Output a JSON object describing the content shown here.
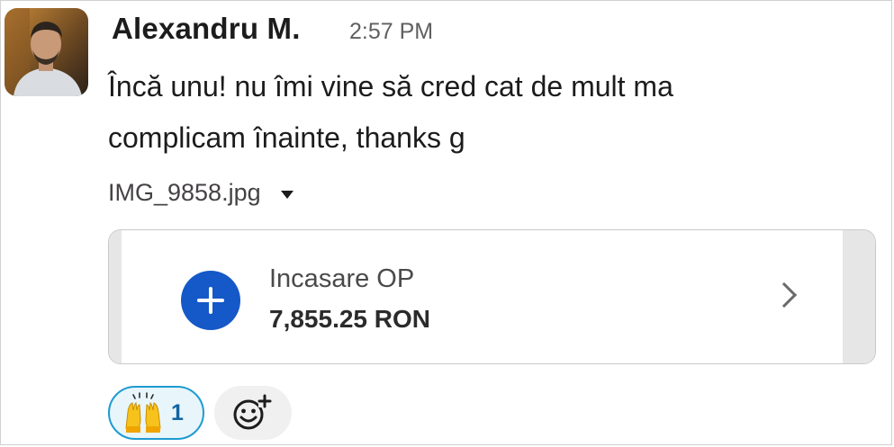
{
  "message": {
    "sender": "Alexandru M.",
    "time": "2:57 PM",
    "text_line1": "Încă unu! nu îmi vine să cred cat de mult ma",
    "text_line2": "complicam înainte, thanks g"
  },
  "attachment": {
    "file_name": "IMG_9858.jpg",
    "preview": {
      "label": "Incasare OP",
      "amount": "7,855.25 RON"
    }
  },
  "reactions": [
    {
      "emoji_name": "raised-hands-icon",
      "count": "1"
    }
  ],
  "colors": {
    "accent_blue": "#1558c7",
    "reaction_border": "#1d9bd1",
    "reaction_bg": "#e8f5fa",
    "reaction_count": "#1264a3"
  }
}
